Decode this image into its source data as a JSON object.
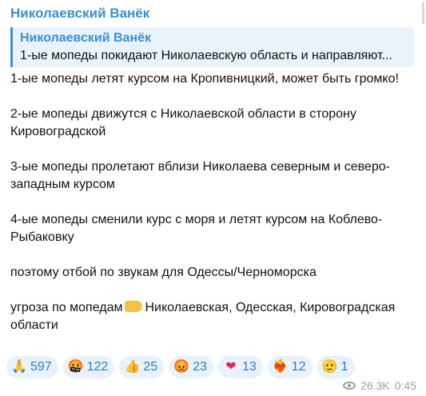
{
  "channel_name": "Николаевский Ванёк",
  "reply": {
    "author": "Николаевский Ванёк",
    "text": "1-ые мопеды покидают Николаевскую область и направляют..."
  },
  "message": {
    "lines": [
      "1-ые мопеды летят курсом на Кропивницкий, может быть громко!",
      "2-ые мопеды движутся с Николаевской области в сторону Кировоградской",
      "3-ые мопеды пролетают вблизи Николаева северным и северо-западным курсом",
      "4-ые мопеды сменили курс с моря и летят курсом на Коблево-Рыбаковку",
      "поэтому отбой по звукам для Одессы/Черноморска"
    ],
    "last_prefix": "угроза по мопедам",
    "last_suffix": "Николаевская, Одесская, Кировоградская области"
  },
  "reactions": [
    {
      "emoji": "🙏",
      "icon": "praying-hands-icon",
      "count": "597"
    },
    {
      "emoji": "🤬",
      "icon": "cursing-face-icon",
      "count": "122"
    },
    {
      "emoji": "👍",
      "icon": "thumbs-up-icon",
      "count": "25"
    },
    {
      "emoji": "😡",
      "icon": "angry-face-icon",
      "count": "23"
    },
    {
      "emoji": "❤",
      "icon": "heart-icon",
      "count": "13"
    },
    {
      "emoji": "❤️‍🔥",
      "icon": "heart-on-fire-icon",
      "count": "12"
    },
    {
      "emoji": "🫡",
      "icon": "salute-icon",
      "count": "1"
    }
  ],
  "meta": {
    "views": "26.3K",
    "time": "0:45"
  },
  "colors": {
    "accent": "#3a8fd6",
    "reaction_bg": "#e9f1fa",
    "reaction_text": "#2b7dd0"
  }
}
